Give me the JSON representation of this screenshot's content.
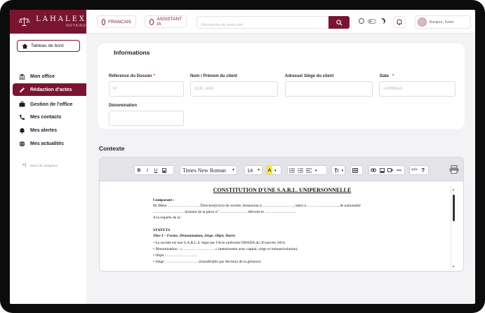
{
  "brand": {
    "name": "LAHALEX",
    "sub": "NOTAIRE"
  },
  "header": {
    "lang_label": "FRANCAIS",
    "assistant_label": "ASSISTANT IA",
    "search_placeholder": "Recherche de mots-clés",
    "user_greeting": "Bonjour, Fetel"
  },
  "sidebar": {
    "dashboard_label": "Tableau de bord",
    "items": [
      {
        "label": "Mon office",
        "icon": "bank-icon"
      },
      {
        "label": "Rédaction d'actes",
        "icon": "pen-icon",
        "active": true
      },
      {
        "label": "Gestion de l'office",
        "icon": "briefcase-icon"
      },
      {
        "label": "Mes contacts",
        "icon": "phone-icon"
      },
      {
        "label": "Mes alertes",
        "icon": "bell-icon"
      },
      {
        "label": "Mes actualités",
        "icon": "globe-icon"
      }
    ],
    "collapse_label": "Barre de navigation"
  },
  "informations": {
    "title": "Informations",
    "fields": {
      "reference": {
        "label": "Référence du Dossier",
        "required": true,
        "placeholder": "N°"
      },
      "nom": {
        "label": "Nom / Prénom du client",
        "required": false,
        "placeholder": "DOE John"
      },
      "adresse": {
        "label": "Adresse/ Siège du client",
        "required": false,
        "placeholder": ""
      },
      "date": {
        "label": "Date",
        "required": true,
        "placeholder": "JJ/MM/AA"
      },
      "denomination": {
        "label": "Dénomination",
        "required": false,
        "placeholder": ""
      }
    }
  },
  "contexte": {
    "title": "Contexte",
    "toolbar": {
      "bold": "B",
      "italic": "I",
      "underline": "U",
      "font": "Times New Roman",
      "size": "14",
      "highlight": "A"
    },
    "document": {
      "title": "CONSTITUTION D'UNE S.A.R.L. UNIPERSONNELLE",
      "comparant_label": "Comparant :",
      "line1": "M./Mme ……………………, Directeur(trice) de société, demeurant à ……………………, né(e) à ……………………, de nationalité",
      "line2": "…………………… titulaire de la pièce n°…………………. délivrée le ……………………",
      "line3": "A la requête de la :",
      "statuts_label": "STATUTS",
      "titre1": "Titre I – Forme, Dénomination, Siège, Objet, Durée",
      "bullet1": "La société est une S.A.R.L.U régie par l'Acte uniforme OHADA du 30 janvier 2014.",
      "bullet2": "Dénomination : « …………………… » (mentionnée avec capital, siège et immatriculation).",
      "bullet3": "Objet : ……………………",
      "bullet4": "Siège : …………………… (transférable par décision de la gérance)."
    }
  },
  "colors": {
    "brand": "#7a1431",
    "required": "#d21f3c"
  }
}
